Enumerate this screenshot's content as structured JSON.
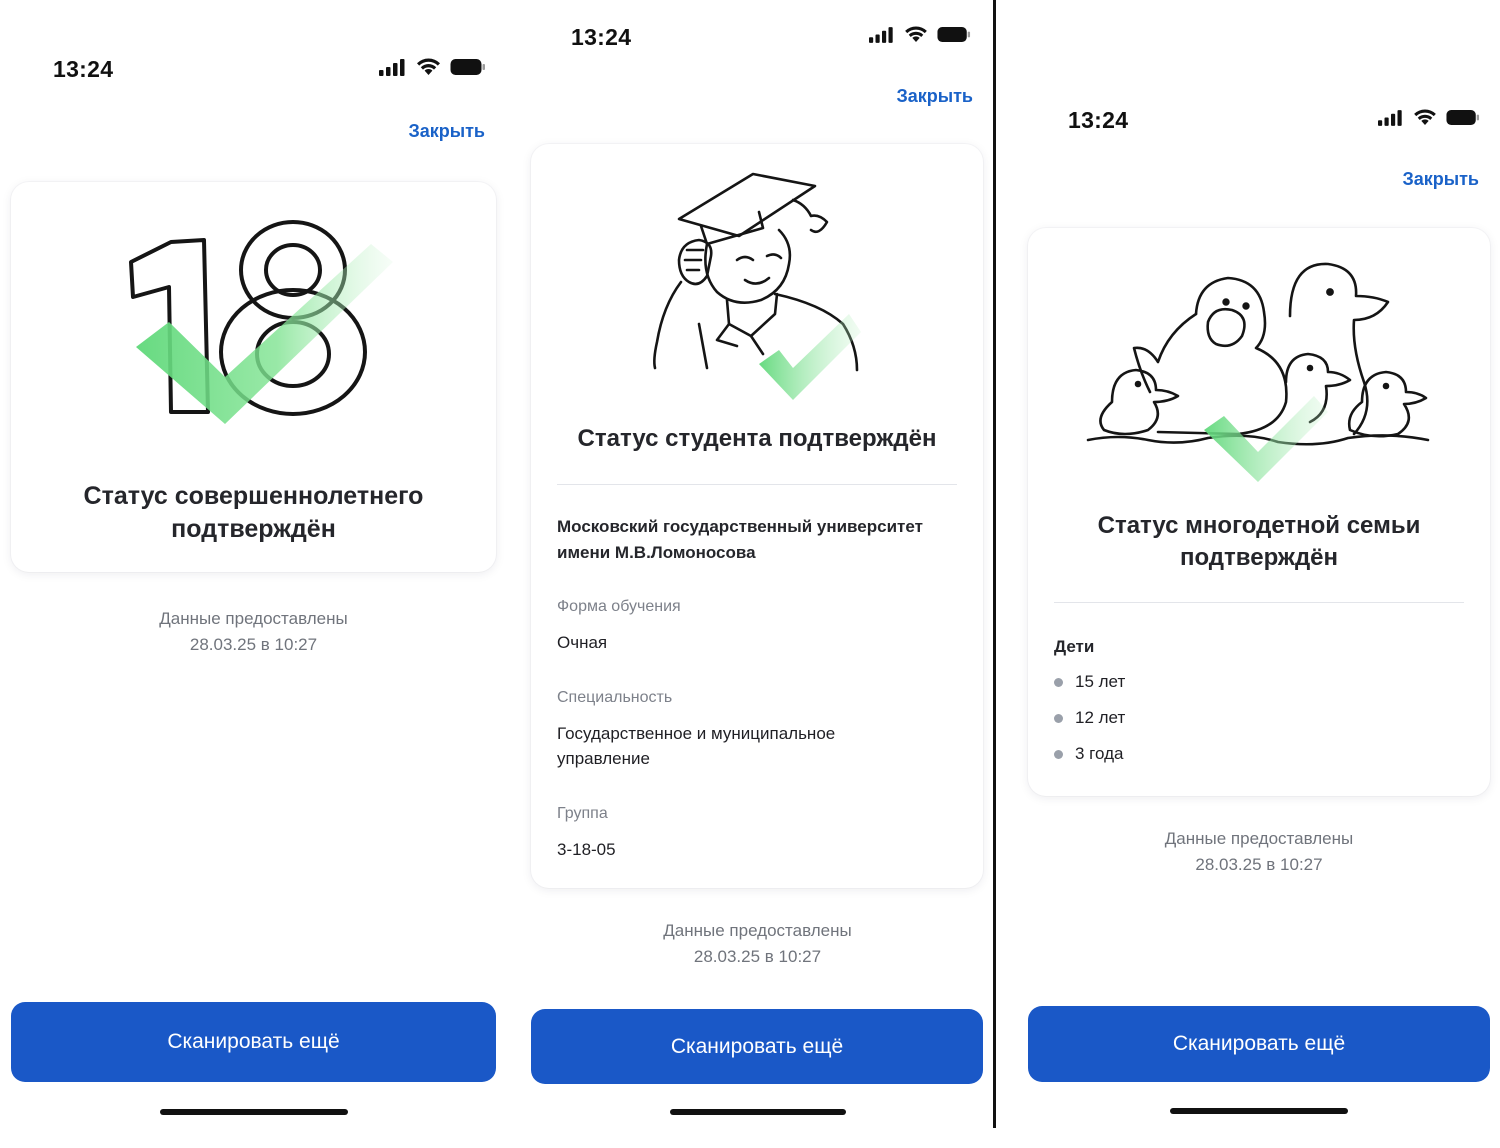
{
  "status_bar": {
    "time": "13:24"
  },
  "close_label": "Закрыть",
  "scan_label": "Сканировать ещё",
  "provided": {
    "line1": "Данные предоставлены",
    "line2": "28.03.25 в 10:27"
  },
  "screen_adult": {
    "badge_number": "18",
    "title_line1": "Статус совершеннолетнего",
    "title_line2": "подтверждён"
  },
  "screen_student": {
    "title": "Статус студента подтверждён",
    "university_line1": "Московский государственный университет",
    "university_line2": "имени М.В.Ломоносова",
    "fields": [
      {
        "label": "Форма обучения",
        "value": "Очная"
      },
      {
        "label": "Специальность",
        "value_line1": "Государственное и муниципальное",
        "value_line2": "управление"
      },
      {
        "label": "Группа",
        "value": "3-18-05"
      }
    ]
  },
  "screen_family": {
    "title_line1": "Статус многодетной семьи",
    "title_line2": "подтверждён",
    "children_label": "Дети",
    "children": [
      "15 лет",
      "12 лет",
      "3 года"
    ]
  },
  "colors": {
    "accent": "#1a58c7",
    "link": "#1a62c8",
    "check": "#5fd87a"
  },
  "icons": [
    "signal-icon",
    "wifi-icon",
    "battery-icon",
    "checkmark-icon",
    "graduate-illustration",
    "ducks-illustration"
  ]
}
